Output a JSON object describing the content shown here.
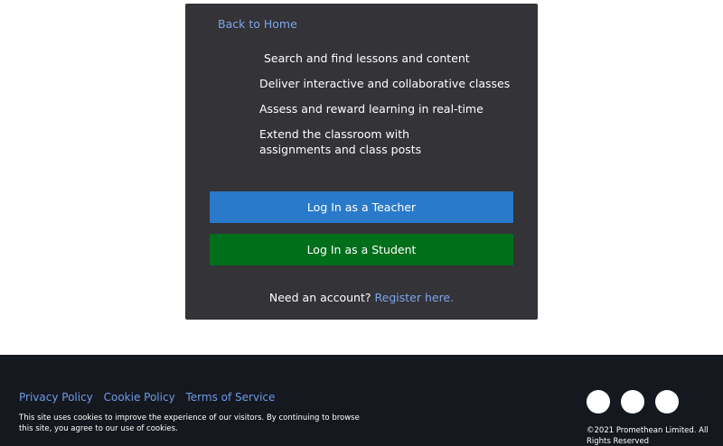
{
  "card": {
    "back_label": "Back to Home",
    "features": [
      "Search and find lessons and content",
      "Deliver interactive and collaborative classes",
      "Assess and reward learning in real-time",
      "Extend the classroom with assignments and class posts"
    ],
    "teacher_button": "Log In as a Teacher",
    "student_button": "Log In as a Student",
    "register_prompt": "Need an account?",
    "register_link": "Register here."
  },
  "footer": {
    "links": [
      "Privacy Policy",
      "Cookie Policy",
      "Terms of Service"
    ],
    "cookie_notice": "This site uses cookies to improve the experience of our visitors. By continuing to browse this site, you agree to our use of cookies.",
    "copyright": "©2021 Promethean Limited. All Rights Reserved",
    "social_icons": [
      "social-icon-1",
      "social-icon-2",
      "social-icon-3"
    ]
  },
  "colors": {
    "card_bg": "#333338",
    "teacher_button": "#2a7acb",
    "student_button": "#006f1a",
    "link": "#7ea6e8",
    "footer_bg": "#16181f"
  }
}
